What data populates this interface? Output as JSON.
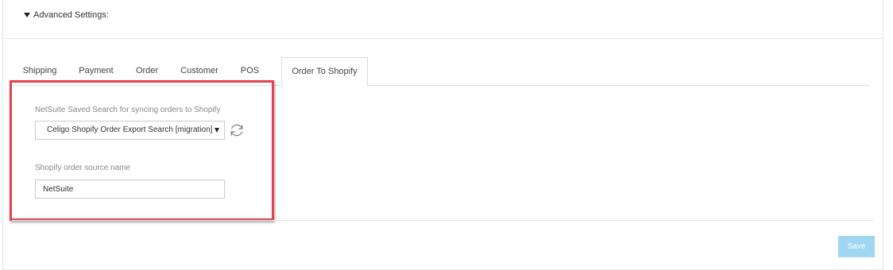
{
  "advanced_settings": {
    "label": "Advanced Settings:"
  },
  "tabs": [
    {
      "label": "Shipping"
    },
    {
      "label": "Payment"
    },
    {
      "label": "Order"
    },
    {
      "label": "Customer"
    },
    {
      "label": "POS"
    },
    {
      "label": "Order To Shopify",
      "active": true
    }
  ],
  "form": {
    "saved_search_label": "NetSuite Saved Search for syncing orders to Shopify",
    "saved_search_value": "Celigo Shopify Order Export Search [migration]",
    "source_name_label": "Shopify order source name",
    "source_name_value": "NetSuite"
  },
  "footer": {
    "save_label": "Save"
  },
  "colors": {
    "highlight_border": "#e3434f",
    "save_button": "#9fd6f2"
  }
}
